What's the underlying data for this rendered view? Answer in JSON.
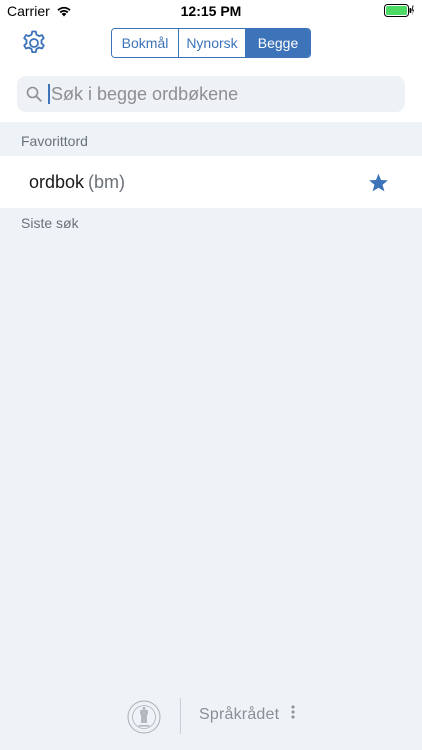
{
  "status_bar": {
    "carrier": "Carrier",
    "time": "12:15 PM",
    "wifi_icon": "wifi-icon",
    "battery_icon": "battery-icon",
    "battery_level": 1.0,
    "battery_color": "#4cd964"
  },
  "topbar": {
    "settings_icon": "gear-icon",
    "segments": [
      {
        "label": "Bokmål",
        "selected": false
      },
      {
        "label": "Nynorsk",
        "selected": false
      },
      {
        "label": "Begge",
        "selected": true
      }
    ]
  },
  "search": {
    "placeholder": "Søk i begge ordbøkene",
    "value": "",
    "icon": "search-icon"
  },
  "favorites": {
    "header": "Favorittord",
    "items": [
      {
        "word": "ordbok",
        "dictionary": "(bm)",
        "starred": true,
        "icon": "star-icon"
      }
    ]
  },
  "recent": {
    "header": "Siste søk"
  },
  "footer": {
    "left_logo": "university-seal-icon",
    "right_logo": "Språkrådet"
  },
  "colors": {
    "accent": "#3d73b8",
    "background": "#eef3f7",
    "row_background": "#ffffff",
    "secondary_text": "#6b7178"
  }
}
